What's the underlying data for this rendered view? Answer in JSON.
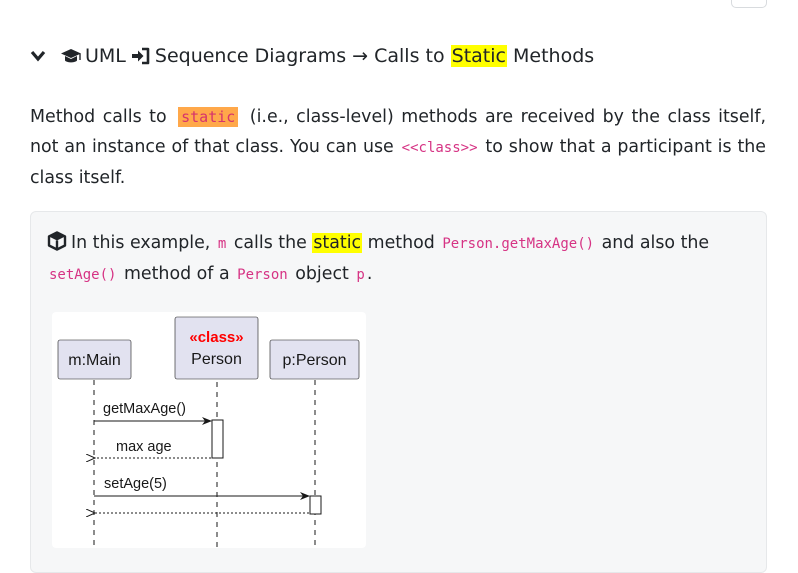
{
  "heading": {
    "part1": "UML",
    "part2": "Sequence Diagrams → Calls to ",
    "highlight": "Static",
    "part3": " Methods",
    "icons": [
      "chevron-down-icon",
      "graduation-cap-icon",
      "sign-in-icon"
    ]
  },
  "paragraph": {
    "t1": "Method calls to",
    "code1": "static",
    "t2": "(i.e., class-level) methods are received by the class itself, not an instance of that class. You can use",
    "code2": "<<class>>",
    "t3": "to show that a participant is the class itself."
  },
  "example": {
    "icon": "cube-icon",
    "t1": "In this example,",
    "code_m": "m",
    "t2": "calls the",
    "highlight": "static",
    "t3": "method",
    "code_method": "Person.getMaxAge()",
    "t4": "and also the",
    "code_setage": "setAge()",
    "t5": "method of a",
    "code_person": "Person",
    "t6": "object",
    "code_p": "p",
    "t7": "."
  },
  "diagram": {
    "participants": {
      "main": "m:Main",
      "stereotype": "«class»",
      "person_class": "Person",
      "person_obj": "p:Person"
    },
    "messages": {
      "call1": "getMaxAge()",
      "return1": "max age",
      "call2": "setAge(5)"
    },
    "colors": {
      "participant_fill": "#e2e2f0",
      "participant_border": "#181818",
      "stereotype": "#ff0000",
      "lifeline": "#181818"
    }
  }
}
